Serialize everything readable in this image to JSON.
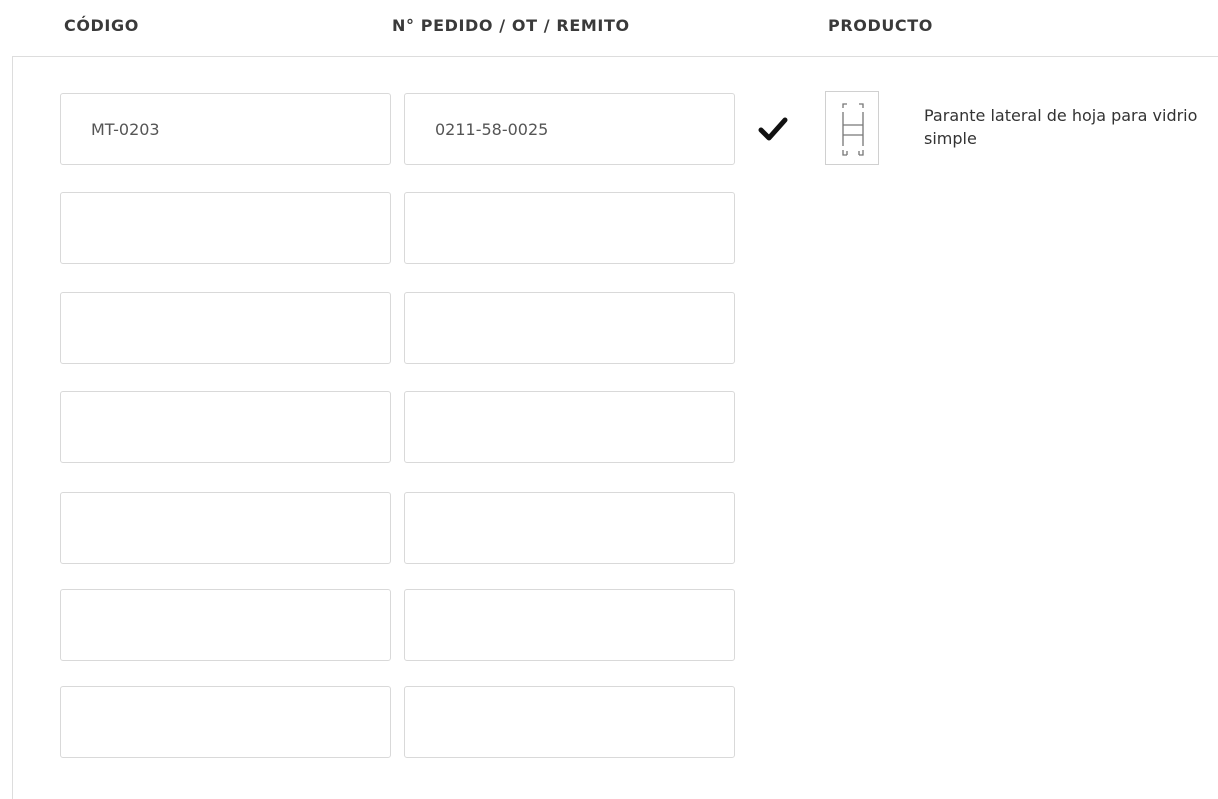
{
  "headers": {
    "codigo": "CÓDIGO",
    "pedido": "N° PEDIDO / OT / REMITO",
    "producto": "PRODUCTO"
  },
  "rows": [
    {
      "codigo": "MT-0203",
      "pedido": "0211-58-0025"
    },
    {
      "codigo": "",
      "pedido": ""
    },
    {
      "codigo": "",
      "pedido": ""
    },
    {
      "codigo": "",
      "pedido": ""
    },
    {
      "codigo": "",
      "pedido": ""
    },
    {
      "codigo": "",
      "pedido": ""
    },
    {
      "codigo": "",
      "pedido": ""
    }
  ],
  "product": {
    "description": "Parante lateral de hoja para vidrio simple",
    "validated": true,
    "validation_icon": "check-icon",
    "thumbnail_icon": "profile-drawing-icon"
  },
  "colors": {
    "border": "#d9d9d9",
    "header_text": "#3a3a3a",
    "value_text": "#555555",
    "check": "#111111"
  }
}
